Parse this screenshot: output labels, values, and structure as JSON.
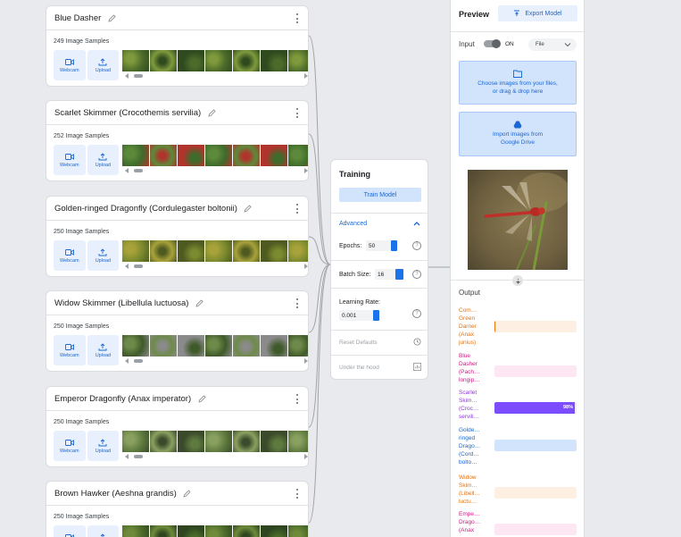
{
  "classes": [
    {
      "name": "Blue Dasher",
      "samples": "249 Image Samples"
    },
    {
      "name": "Scarlet Skimmer (Crocothemis servilia)",
      "samples": "252 Image Samples"
    },
    {
      "name": "Golden-ringed Dragonfly (Cordulegaster boltonii)",
      "samples": "250 Image Samples"
    },
    {
      "name": "Widow Skimmer (Libellula luctuosa)",
      "samples": "250 Image Samples"
    },
    {
      "name": "Emperor Dragonfly (Anax imperator)",
      "samples": "250 Image Samples"
    },
    {
      "name": "Brown Hawker (Aeshna grandis)",
      "samples": "250 Image Samples"
    }
  ],
  "source_buttons": {
    "webcam": "Webcam",
    "upload": "Upload"
  },
  "icons": {
    "edit": "pencil-icon",
    "menu": "more-vert-icon",
    "webcam": "videocam-icon",
    "upload": "upload-icon",
    "export": "export-icon",
    "folder": "folder-icon",
    "drive": "google-drive-icon",
    "history": "history-icon",
    "chart": "bar-chart-icon",
    "help": "help-icon",
    "chevron": "chevron-icon"
  },
  "training": {
    "title": "Training",
    "train_button": "Train Model",
    "advanced": "Advanced",
    "epochs_label": "Epochs:",
    "epochs_value": "50",
    "batch_label": "Batch Size:",
    "batch_value": "16",
    "lr_label": "Learning Rate:",
    "lr_value": "0.001",
    "reset": "Reset Defaults",
    "under_hood": "Under the hood",
    "help_glyph": "?"
  },
  "preview": {
    "title": "Preview",
    "export_button": "Export Model",
    "input_label": "Input",
    "toggle_state": "ON",
    "source_select": "File",
    "choose_files": [
      "Choose images from your files,",
      "or drag & drop here"
    ],
    "drive_import": [
      "Import images from",
      "Google Drive"
    ],
    "output_title": "Output"
  },
  "outputs": [
    {
      "label": [
        "Com…",
        "Green",
        "Darner",
        "(Anax",
        "junius)"
      ],
      "color": "#e8710a",
      "track": "#feefe3",
      "confidence": 1,
      "pct": ""
    },
    {
      "label": [
        "Blue",
        "Dasher",
        "(Pach…",
        "longip…"
      ],
      "color": "#d01884",
      "track": "#fde7f3",
      "confidence": 0,
      "pct": ""
    },
    {
      "label": [
        "Scarlet",
        "Skim…",
        "(Croc…",
        "servili…"
      ],
      "color": "#9334e6",
      "track": "#f3e8fd",
      "confidence": 98,
      "pct": "98%"
    },
    {
      "label": [
        "Golde…",
        "ringed",
        "Drago…",
        "(Cord…",
        "bolto…"
      ],
      "color": "#1967d2",
      "track": "#d2e3fc",
      "confidence": 0,
      "pct": ""
    },
    {
      "label": [
        "Widow",
        "Skim…",
        "(Libell…",
        "luctu…"
      ],
      "color": "#e8710a",
      "track": "#feefe3",
      "confidence": 0,
      "pct": ""
    },
    {
      "label": [
        "Empe…",
        "Drago…",
        "(Anax"
      ],
      "color": "#d01884",
      "track": "#fde7f3",
      "confidence": 0,
      "pct": ""
    }
  ],
  "colors": {
    "accent": "#1a73e8",
    "accent_light": "#d2e3fc",
    "scarlet_bar": "#7c4dff"
  }
}
